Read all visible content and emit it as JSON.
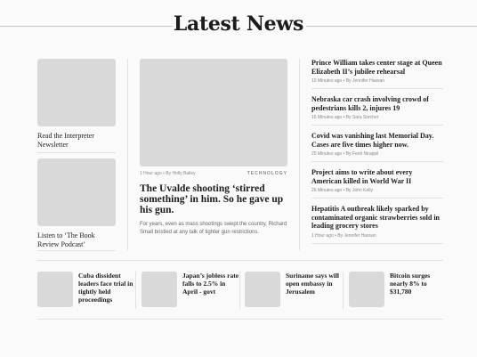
{
  "header": {
    "title": "Latest News"
  },
  "left_cards": [
    {
      "caption": "Read the Interpreter Newsletter"
    },
    {
      "caption": "Listen to ‘The Book Review Podcast’"
    }
  ],
  "feature": {
    "meta": "1 Hour ago  •  By Holly Bailey",
    "tag": "TECHNOLOGY",
    "headline": "The Uvalde shooting ‘stirred something’ in him. So he gave up his gun.",
    "summary": "For years, even as mass shootings swept the country, Richard Small bristled at any talk of tighter gun restrictions."
  },
  "right_list": [
    {
      "title": "Prince William takes center stage at Queen Elizabeth II’s jubilee rehearsal",
      "meta": "10 Minutes ago  •  By Jennifer Hassan"
    },
    {
      "title": "Nebraska car crash involving crowd of pedestrians kills 2, injures 19",
      "meta": "16 Minutes ago  •  By Sara Sorcher"
    },
    {
      "title": "Covid was vanishing last Memorial Day. Cases are five times higher now.",
      "meta": "20 Minutes ago  •  By Fenit Nirappil"
    },
    {
      "title": "Project aims to write about every American killed in World War II",
      "meta": "26 Minutes ago  •  By John Kelly"
    },
    {
      "title": "Hepatitis A outbreak likely sparked by contaminated organic strawberries sold in leading grocery stores",
      "meta": "1 Hour ago  •  By Jennifer Hassan"
    }
  ],
  "bottom_list": [
    {
      "title": "Cuba dissident leaders face trial in tightly held proceedings"
    },
    {
      "title": "Japan’s jobless rate falls to 2.5% in April - govt"
    },
    {
      "title": "Suriname says will open embassy in Jerusalem"
    },
    {
      "title": "Bitcoin surges nearly 8% to $31,780"
    }
  ]
}
